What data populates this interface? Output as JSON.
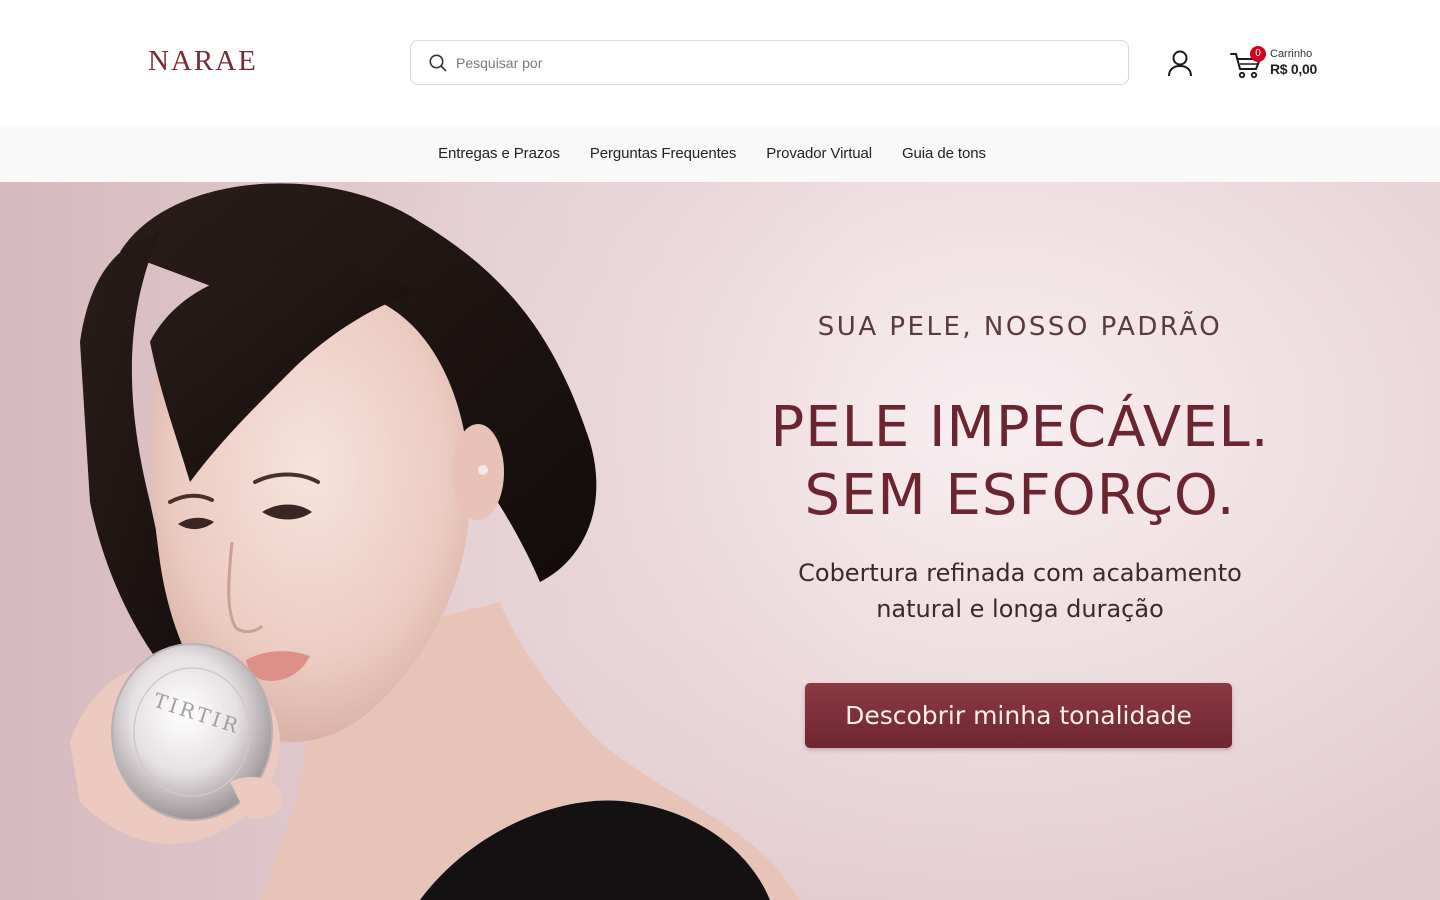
{
  "header": {
    "logo": "NARAE",
    "search": {
      "placeholder": "Pesquisar por",
      "value": ""
    },
    "cart": {
      "count": "0",
      "label": "Carrinho",
      "total": "R$ 0,00"
    }
  },
  "nav": {
    "items": [
      {
        "label": "Entregas e Prazos"
      },
      {
        "label": "Perguntas Frequentes"
      },
      {
        "label": "Provador Virtual"
      },
      {
        "label": "Guia de tons"
      }
    ]
  },
  "hero": {
    "eyebrow": "SUA PELE, NOSSO PADRÃO",
    "headline_line1": "PELE IMPECÁVEL.",
    "headline_line2": "SEM ESFORÇO.",
    "sub_line1": "Cobertura refinada com acabamento",
    "sub_line2": "natural e longa duração",
    "cta": "Descobrir minha tonalidade",
    "product_label": "TIRTIR"
  },
  "colors": {
    "brand": "#7a2a33",
    "cta_bg": "#7a2f39",
    "badge": "#d0021b",
    "nav_bg": "#f9f9f9"
  },
  "icons": {
    "search": "search-icon",
    "account": "user-icon",
    "cart": "cart-icon"
  }
}
